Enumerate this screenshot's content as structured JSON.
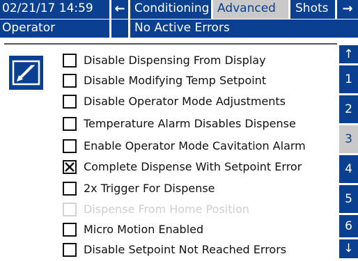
{
  "header": {
    "datetime": "02/21/17 14:59",
    "prev_icon": "arrow-left-icon",
    "tabs": [
      {
        "label": "Conditioning",
        "selected": false
      },
      {
        "label": "Advanced",
        "selected": true
      },
      {
        "label": "Shots",
        "selected": false
      }
    ],
    "next_icon": "arrow-right-icon"
  },
  "status": {
    "mode": "Operator",
    "errors": "No Active Errors"
  },
  "edit_button_icon": "edit-icon",
  "options": [
    {
      "label": "Disable Dispensing From Display",
      "checked": false,
      "enabled": true
    },
    {
      "label": "Disable Modifying Temp Setpoint",
      "checked": false,
      "enabled": true
    },
    {
      "label": "Disable Operator Mode Adjustments",
      "checked": false,
      "enabled": true
    },
    {
      "label": "Temperature Alarm Disables Dispense",
      "checked": false,
      "enabled": true
    },
    {
      "label": "Enable Operator Mode Cavitation Alarm",
      "checked": false,
      "enabled": true
    },
    {
      "label": "Complete Dispense With Setpoint Error",
      "checked": true,
      "enabled": true
    },
    {
      "label": "2x Trigger For Dispense",
      "checked": false,
      "enabled": true
    },
    {
      "label": "Dispense From Home Position",
      "checked": false,
      "enabled": false
    },
    {
      "label": "Micro Motion Enabled",
      "checked": false,
      "enabled": true
    },
    {
      "label": "Disable Setpoint Not Reached Errors",
      "checked": false,
      "enabled": true
    }
  ],
  "pages": {
    "up_icon": "arrow-up-icon",
    "down_icon": "arrow-down-icon",
    "numbers": [
      "1",
      "2",
      "3",
      "4",
      "5",
      "6"
    ],
    "current": "3"
  },
  "colors": {
    "accent": "#0b3f8f",
    "selected_bg": "#c9c9c9",
    "disabled_text": "#cfcfcf"
  }
}
